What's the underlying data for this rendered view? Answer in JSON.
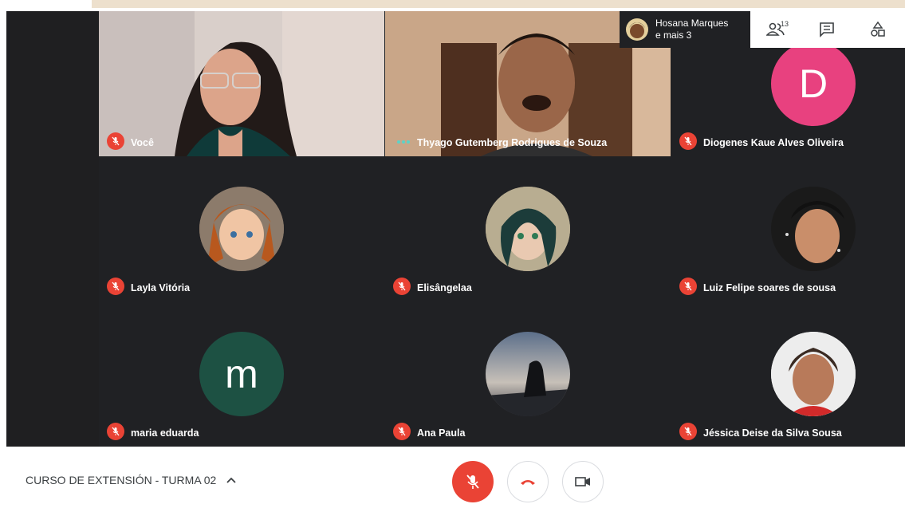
{
  "participants_header": {
    "name": "Hosana Marques",
    "more": "e mais 3"
  },
  "toolbar": {
    "people_count": "13"
  },
  "tiles": [
    {
      "name": "Você",
      "muted": true
    },
    {
      "name": "Thyago Gutemberg Rodrigues de Souza",
      "muted": false
    },
    {
      "name": "Diogenes Kaue Alves Oliveira",
      "muted": true,
      "initial": "D",
      "color": "#e8417f"
    },
    {
      "name": "Layla Vitória",
      "muted": true
    },
    {
      "name": "Elisângelaa",
      "muted": true
    },
    {
      "name": "Luiz Felipe soares de sousa",
      "muted": true
    },
    {
      "name": "maria eduarda",
      "muted": true,
      "initial": "m",
      "color": "#1d5143"
    },
    {
      "name": "Ana Paula",
      "muted": true
    },
    {
      "name": "Jéssica Deise da Silva Sousa",
      "muted": true
    }
  ],
  "meeting": {
    "title": "CURSO DE EXTENSIÓN - TURMA 02"
  },
  "colors": {
    "accent_red": "#ea4335",
    "stage_bg": "#202124"
  }
}
